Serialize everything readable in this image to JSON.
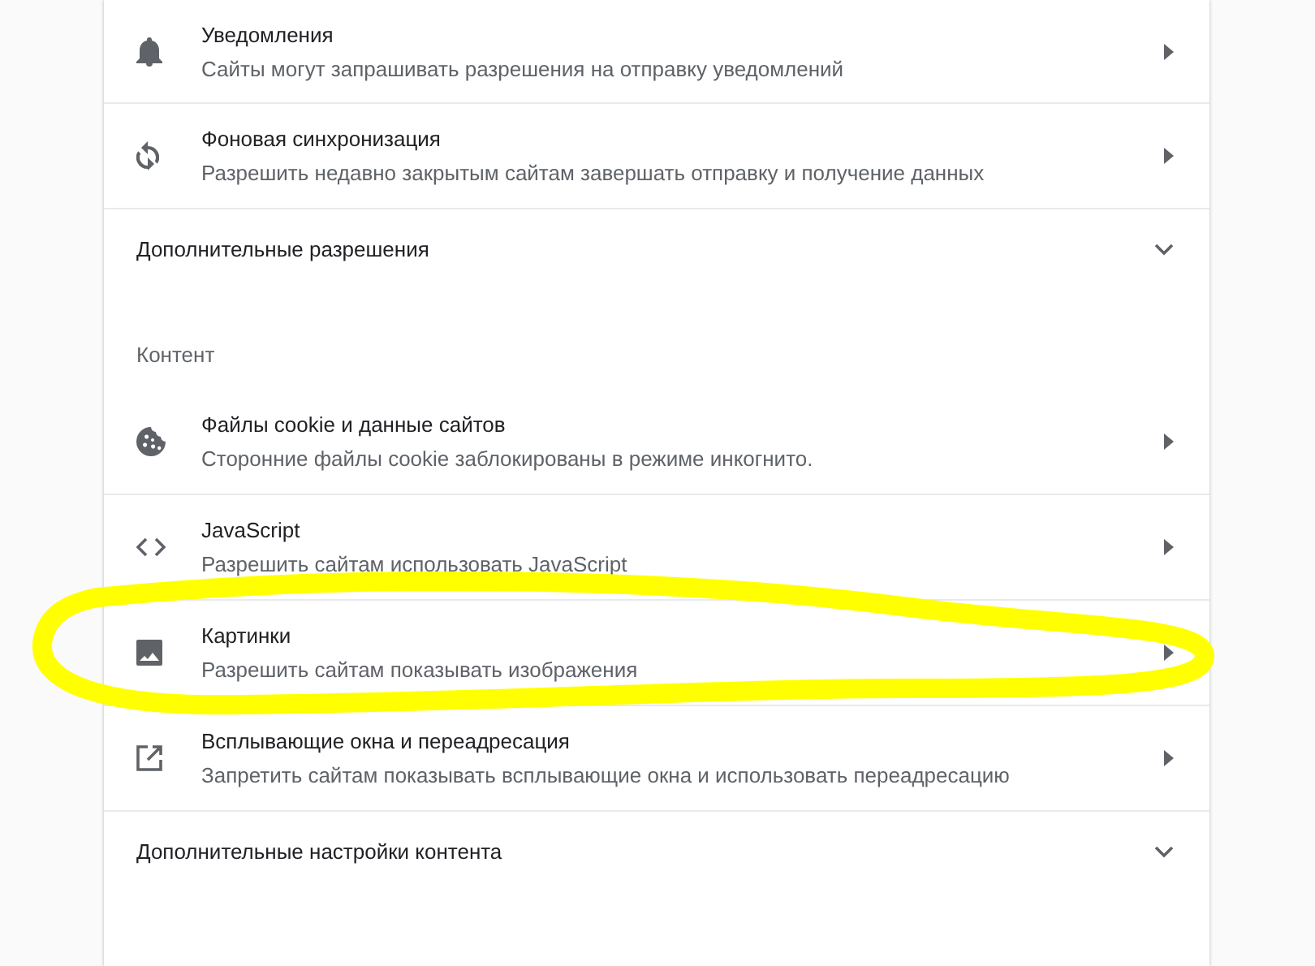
{
  "sections": [
    {
      "items": [
        {
          "kind": "link",
          "title": "Уведомления",
          "subtitle": "Сайты могут запрашивать разрешения на отправку уведомлений"
        },
        {
          "kind": "link",
          "title": "Фоновая синхронизация",
          "subtitle": "Разрешить недавно закрытым сайтам завершать отправку и получение данных"
        },
        {
          "kind": "expander",
          "title": "Дополнительные разрешения",
          "expanded": false
        }
      ]
    },
    {
      "heading": "Контент",
      "items": [
        {
          "kind": "link",
          "title": "Файлы cookie и данные сайтов",
          "subtitle": "Сторонние файлы cookie заблокированы в режиме инкогнито."
        },
        {
          "kind": "link",
          "title": "JavaScript",
          "subtitle": "Разрешить сайтам использовать JavaScript"
        },
        {
          "kind": "link",
          "title": "Картинки",
          "subtitle": "Разрешить сайтам показывать изображения"
        },
        {
          "kind": "link",
          "title": "Всплывающие окна и переадресация",
          "subtitle": "Запретить сайтам показывать всплывающие окна и использовать переадресацию"
        },
        {
          "kind": "expander",
          "title": "Дополнительные настройки контента",
          "expanded": false
        }
      ]
    }
  ]
}
